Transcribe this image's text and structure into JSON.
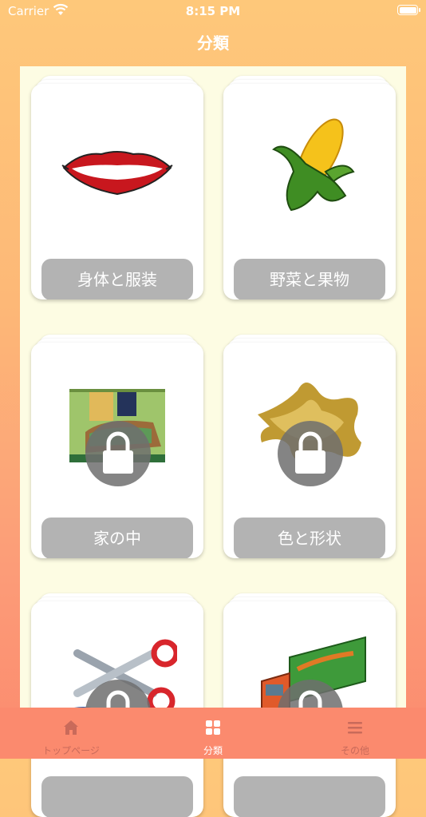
{
  "status": {
    "carrier": "Carrier",
    "time": "8:15 PM"
  },
  "nav": {
    "title": "分類"
  },
  "categories": [
    {
      "label": "身体と服装",
      "icon": "lips-icon",
      "locked": false
    },
    {
      "label": "野菜と果物",
      "icon": "corn-icon",
      "locked": false
    },
    {
      "label": "家の中",
      "icon": "bedroom-icon",
      "locked": true
    },
    {
      "label": "色と形状",
      "icon": "paint-splash-icon",
      "locked": true
    },
    {
      "label": "",
      "icon": "scissors-icon",
      "locked": true
    },
    {
      "label": "",
      "icon": "truck-icon",
      "locked": true
    }
  ],
  "tabbar": {
    "tabs": [
      {
        "label": "トップページ",
        "icon": "home-icon",
        "active": false
      },
      {
        "label": "分類",
        "icon": "grid-icon",
        "active": true
      },
      {
        "label": "その他",
        "icon": "menu-icon",
        "active": false
      }
    ],
    "active_color": "#ffffff",
    "inactive_color": "#c96a5a"
  }
}
